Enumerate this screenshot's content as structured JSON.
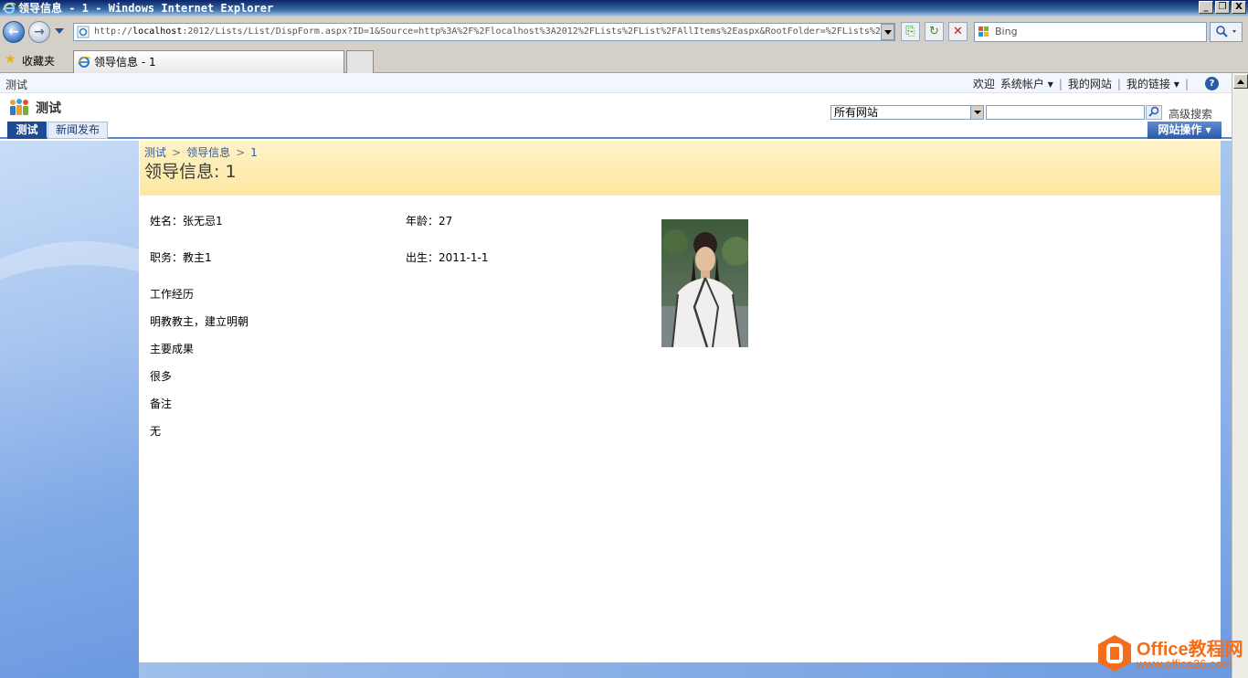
{
  "window": {
    "title": "领导信息 - 1 - Windows Internet Explorer",
    "buttons": [
      "_",
      "❐",
      "X"
    ]
  },
  "browser": {
    "address_scheme": "http://",
    "address_host": "localhost",
    "address_rest": ":2012/Lists/List/DispForm.aspx?ID=1&Source=http%3A%2F%2Flocalhost%3A2012%2FLists%2FList%2FAllItems%2Easpx&RootFolder=%2FLists%2",
    "search_placeholder": "Bing",
    "favorites_label": "收藏夹",
    "tab_title": "领导信息 - 1"
  },
  "sharepoint": {
    "site_crumb": "测试",
    "welcome": "欢迎",
    "account": "系统帐户",
    "my_site": "我的网站",
    "my_links": "我的链接",
    "site_title": "测试",
    "search_scope": "所有网站",
    "advanced_search": "高级搜索",
    "nav_tabs": [
      "测试",
      "新闻发布"
    ],
    "site_actions": "网站操作"
  },
  "page": {
    "breadcrumb": [
      "测试",
      "领导信息",
      "1"
    ],
    "heading": "领导信息: 1"
  },
  "profile": {
    "name": "姓名：张无忌1",
    "age": "年龄：27",
    "position": "职务：教主1",
    "birth": "出生：2011-1-1",
    "experience_label": "工作经历",
    "experience_value": "明教教主，建立明朝",
    "achievements_label": "主要成果",
    "achievements_value": "很多",
    "notes_label": "备注",
    "notes_value": "无"
  },
  "watermark": {
    "brand": "Office教程网",
    "url": "www.office26.com"
  },
  "colors": {
    "title_band": "#fde7a1",
    "nav_active": "#1c4a95",
    "left_pane": "#7fa8e6",
    "watermark": "#f36e1a"
  }
}
